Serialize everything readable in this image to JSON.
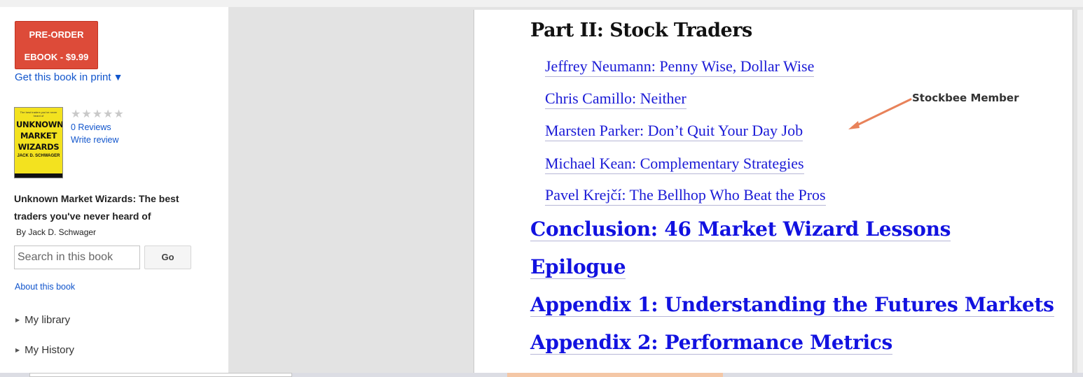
{
  "sidebar": {
    "preorder_line1": "PRE-ORDER",
    "preorder_line2": "EBOOK - $9.99",
    "print_link": "Get this book in print",
    "print_caret": "▼",
    "cover": {
      "small_text": "The best traders you've never heard of",
      "title_line1": "UNKNOWN",
      "title_line2": "MARKET",
      "title_line3": "WIZARDS",
      "author": "JACK D. SCHWAGER"
    },
    "stars": "★★★★★",
    "rating": 0,
    "reviews": "0 Reviews",
    "write_review": "Write review",
    "book_title": "Unknown Market Wizards: The best traders you've never heard of",
    "byline": "By Jack D. Schwager",
    "search_placeholder": "Search in this book",
    "go_label": "Go",
    "about_link": "About this book",
    "nav": {
      "library": "My library",
      "history": "My History"
    }
  },
  "page": {
    "part_heading": "Part II: Stock Traders",
    "sub_entries": [
      "Jeffrey Neumann: Penny Wise, Dollar Wise",
      "Chris Camillo: Neither",
      "Marsten Parker: Don’t Quit Your Day Job",
      "Michael Kean: Complementary Strategies",
      "Pavel Krejčí: The Bellhop Who Beat the Pros"
    ],
    "main_entries": [
      "Conclusion: 46 Market Wizard Lessons",
      "Epilogue",
      "Appendix 1: Understanding the Futures Markets",
      "Appendix 2: Performance Metrics"
    ],
    "annotation": "Stockbee Member"
  },
  "colors": {
    "preorder_bg": "#dd4b39",
    "link": "#1155cc",
    "toc_link": "#1212e0",
    "annotation_arrow": "#e8825a"
  }
}
